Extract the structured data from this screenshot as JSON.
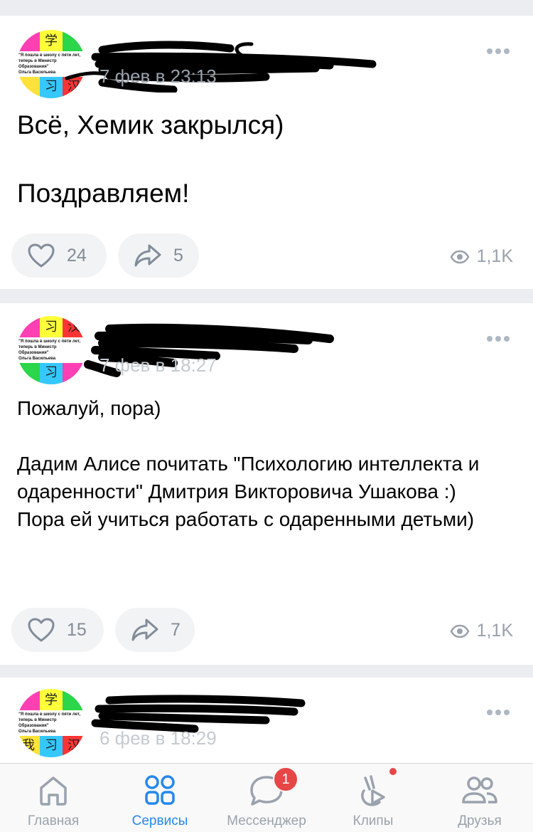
{
  "colors": {
    "accent": "#2688eb",
    "secondary": "#99a2ad",
    "badge": "#e64646",
    "page_bg": "#ebedf0"
  },
  "posts": [
    {
      "date": "7 фев в 23:13",
      "text": "Всё, Хемик закрылся)\n\nПоздравляем!",
      "likes": "24",
      "shares": "5",
      "views": "1,1K"
    },
    {
      "date": "7 фев в 18:27",
      "text": "Пожалуй, пора)\n\nДадим Алисе почитать \"Психологию интеллекта и одаренности\" Дмитрия Викторовича Ушакова :)\nПора ей учиться работать с одаренными детьми)",
      "likes": "15",
      "shares": "7",
      "views": "1,1K"
    },
    {
      "date": "6 фев в 18:29"
    }
  ],
  "avatar": {
    "glyphs": [
      "学",
      "习",
      "汉",
      "我",
      "习",
      "汉"
    ],
    "caption_lines": [
      "\"Я пошла в школу с пяти лет,",
      "теперь в Министр Образования\"",
      "Ольга Васильева"
    ]
  },
  "tabbar": {
    "tabs": [
      {
        "label": "Главная",
        "icon": "home-icon"
      },
      {
        "label": "Сервисы",
        "icon": "services-icon"
      },
      {
        "label": "Мессенджер",
        "icon": "messenger-icon",
        "badge": "1"
      },
      {
        "label": "Клипы",
        "icon": "clips-icon"
      },
      {
        "label": "Друзья",
        "icon": "friends-icon"
      }
    ],
    "active": "Сервисы"
  }
}
